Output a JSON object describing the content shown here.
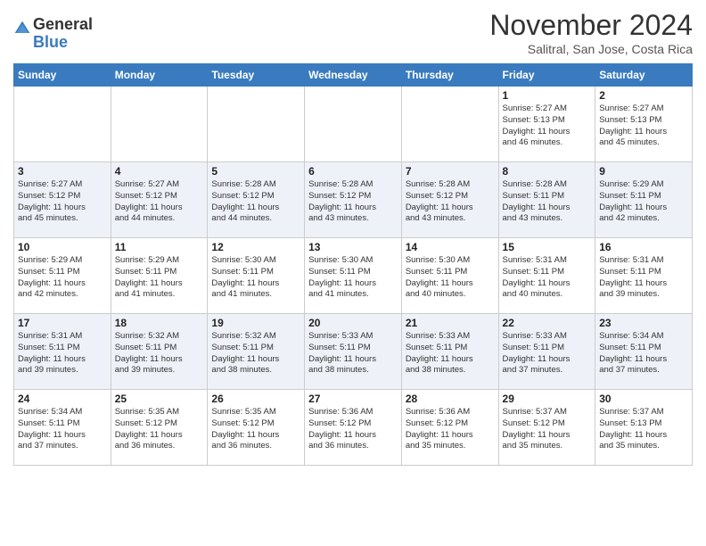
{
  "logo": {
    "general": "General",
    "blue": "Blue"
  },
  "header": {
    "month": "November 2024",
    "location": "Salitral, San Jose, Costa Rica"
  },
  "weekdays": [
    "Sunday",
    "Monday",
    "Tuesday",
    "Wednesday",
    "Thursday",
    "Friday",
    "Saturday"
  ],
  "weeks": [
    [
      {
        "day": "",
        "info": ""
      },
      {
        "day": "",
        "info": ""
      },
      {
        "day": "",
        "info": ""
      },
      {
        "day": "",
        "info": ""
      },
      {
        "day": "",
        "info": ""
      },
      {
        "day": "1",
        "info": "Sunrise: 5:27 AM\nSunset: 5:13 PM\nDaylight: 11 hours\nand 46 minutes."
      },
      {
        "day": "2",
        "info": "Sunrise: 5:27 AM\nSunset: 5:13 PM\nDaylight: 11 hours\nand 45 minutes."
      }
    ],
    [
      {
        "day": "3",
        "info": "Sunrise: 5:27 AM\nSunset: 5:12 PM\nDaylight: 11 hours\nand 45 minutes."
      },
      {
        "day": "4",
        "info": "Sunrise: 5:27 AM\nSunset: 5:12 PM\nDaylight: 11 hours\nand 44 minutes."
      },
      {
        "day": "5",
        "info": "Sunrise: 5:28 AM\nSunset: 5:12 PM\nDaylight: 11 hours\nand 44 minutes."
      },
      {
        "day": "6",
        "info": "Sunrise: 5:28 AM\nSunset: 5:12 PM\nDaylight: 11 hours\nand 43 minutes."
      },
      {
        "day": "7",
        "info": "Sunrise: 5:28 AM\nSunset: 5:12 PM\nDaylight: 11 hours\nand 43 minutes."
      },
      {
        "day": "8",
        "info": "Sunrise: 5:28 AM\nSunset: 5:11 PM\nDaylight: 11 hours\nand 43 minutes."
      },
      {
        "day": "9",
        "info": "Sunrise: 5:29 AM\nSunset: 5:11 PM\nDaylight: 11 hours\nand 42 minutes."
      }
    ],
    [
      {
        "day": "10",
        "info": "Sunrise: 5:29 AM\nSunset: 5:11 PM\nDaylight: 11 hours\nand 42 minutes."
      },
      {
        "day": "11",
        "info": "Sunrise: 5:29 AM\nSunset: 5:11 PM\nDaylight: 11 hours\nand 41 minutes."
      },
      {
        "day": "12",
        "info": "Sunrise: 5:30 AM\nSunset: 5:11 PM\nDaylight: 11 hours\nand 41 minutes."
      },
      {
        "day": "13",
        "info": "Sunrise: 5:30 AM\nSunset: 5:11 PM\nDaylight: 11 hours\nand 41 minutes."
      },
      {
        "day": "14",
        "info": "Sunrise: 5:30 AM\nSunset: 5:11 PM\nDaylight: 11 hours\nand 40 minutes."
      },
      {
        "day": "15",
        "info": "Sunrise: 5:31 AM\nSunset: 5:11 PM\nDaylight: 11 hours\nand 40 minutes."
      },
      {
        "day": "16",
        "info": "Sunrise: 5:31 AM\nSunset: 5:11 PM\nDaylight: 11 hours\nand 39 minutes."
      }
    ],
    [
      {
        "day": "17",
        "info": "Sunrise: 5:31 AM\nSunset: 5:11 PM\nDaylight: 11 hours\nand 39 minutes."
      },
      {
        "day": "18",
        "info": "Sunrise: 5:32 AM\nSunset: 5:11 PM\nDaylight: 11 hours\nand 39 minutes."
      },
      {
        "day": "19",
        "info": "Sunrise: 5:32 AM\nSunset: 5:11 PM\nDaylight: 11 hours\nand 38 minutes."
      },
      {
        "day": "20",
        "info": "Sunrise: 5:33 AM\nSunset: 5:11 PM\nDaylight: 11 hours\nand 38 minutes."
      },
      {
        "day": "21",
        "info": "Sunrise: 5:33 AM\nSunset: 5:11 PM\nDaylight: 11 hours\nand 38 minutes."
      },
      {
        "day": "22",
        "info": "Sunrise: 5:33 AM\nSunset: 5:11 PM\nDaylight: 11 hours\nand 37 minutes."
      },
      {
        "day": "23",
        "info": "Sunrise: 5:34 AM\nSunset: 5:11 PM\nDaylight: 11 hours\nand 37 minutes."
      }
    ],
    [
      {
        "day": "24",
        "info": "Sunrise: 5:34 AM\nSunset: 5:11 PM\nDaylight: 11 hours\nand 37 minutes."
      },
      {
        "day": "25",
        "info": "Sunrise: 5:35 AM\nSunset: 5:12 PM\nDaylight: 11 hours\nand 36 minutes."
      },
      {
        "day": "26",
        "info": "Sunrise: 5:35 AM\nSunset: 5:12 PM\nDaylight: 11 hours\nand 36 minutes."
      },
      {
        "day": "27",
        "info": "Sunrise: 5:36 AM\nSunset: 5:12 PM\nDaylight: 11 hours\nand 36 minutes."
      },
      {
        "day": "28",
        "info": "Sunrise: 5:36 AM\nSunset: 5:12 PM\nDaylight: 11 hours\nand 35 minutes."
      },
      {
        "day": "29",
        "info": "Sunrise: 5:37 AM\nSunset: 5:12 PM\nDaylight: 11 hours\nand 35 minutes."
      },
      {
        "day": "30",
        "info": "Sunrise: 5:37 AM\nSunset: 5:13 PM\nDaylight: 11 hours\nand 35 minutes."
      }
    ]
  ]
}
